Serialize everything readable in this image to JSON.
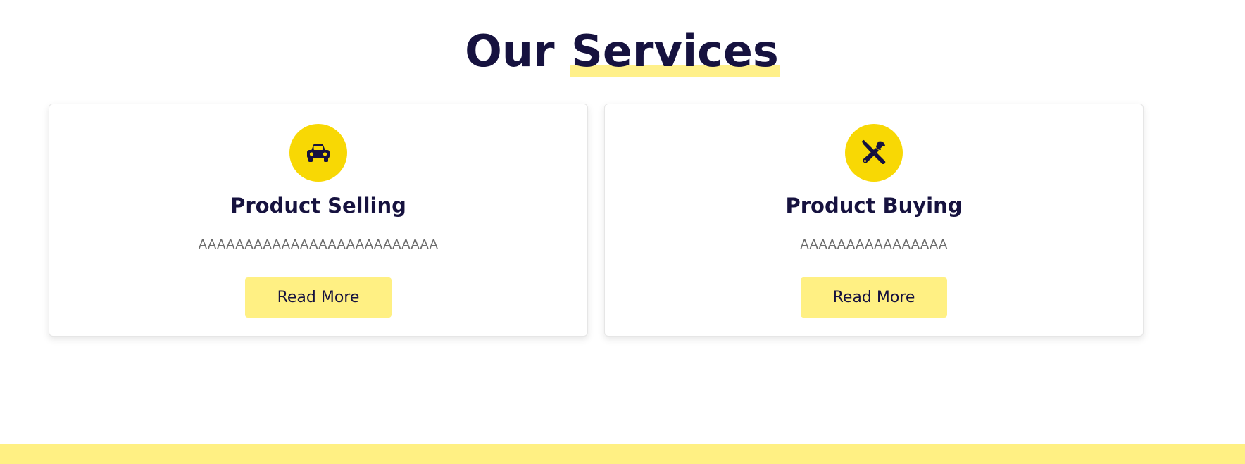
{
  "section": {
    "title_plain": "Our",
    "title_highlight": "Services"
  },
  "services": [
    {
      "icon": "car-icon",
      "title": "Product Selling",
      "description": "AAAAAAAAAAAAAAAAAAAAAAAAAA",
      "button_label": "Read More"
    },
    {
      "icon": "tools-icon",
      "title": "Product Buying",
      "description": "AAAAAAAAAAAAAAAA",
      "button_label": "Read More"
    }
  ],
  "colors": {
    "primary_text": "#16123f",
    "icon_circle": "#f8d804",
    "button_bg": "#fff083",
    "highlight": "#fff08a",
    "muted_text": "#6b6b6b",
    "footer_band": "#fff083"
  }
}
